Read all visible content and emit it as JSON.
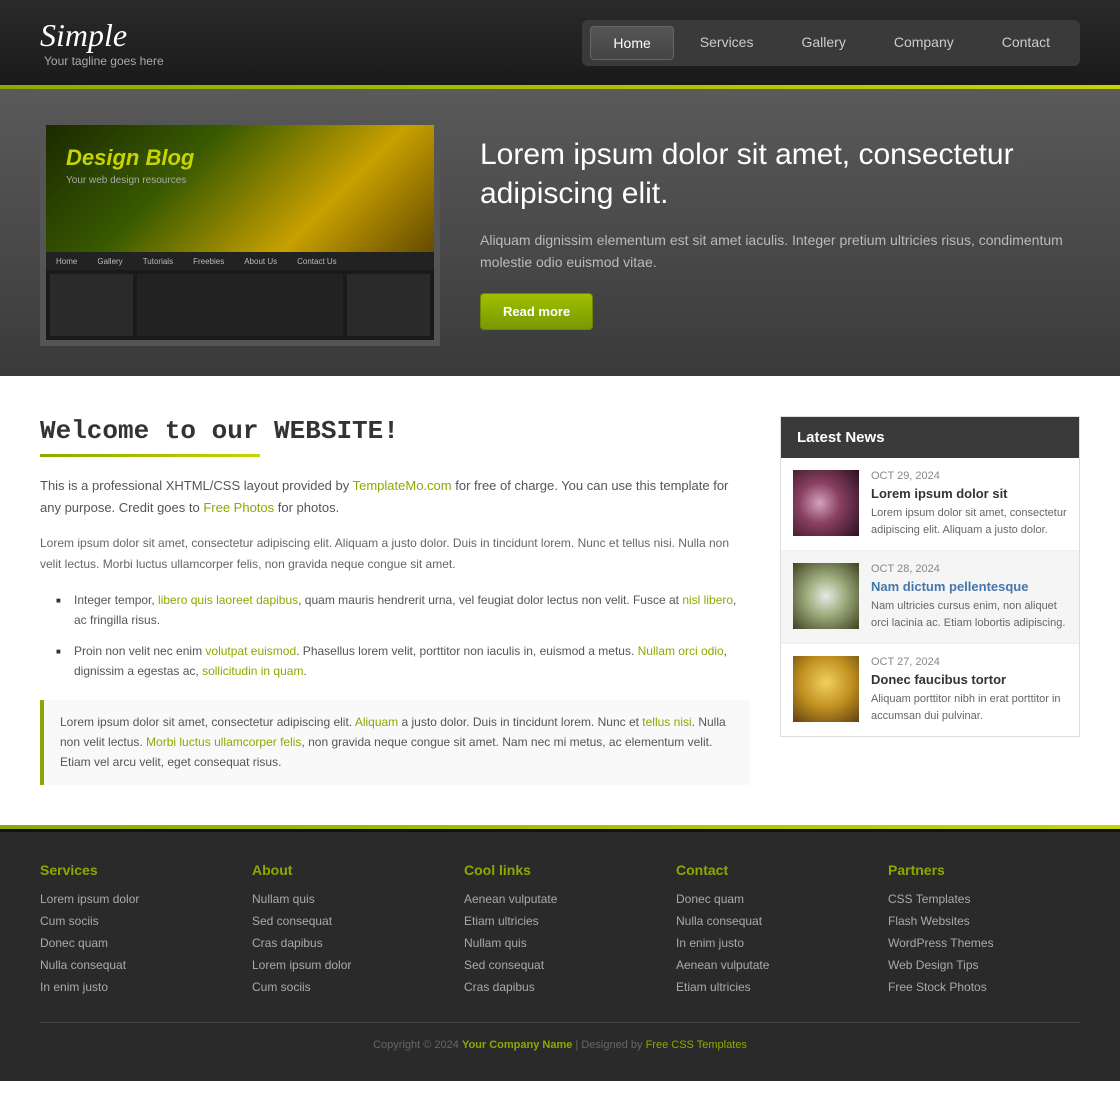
{
  "site": {
    "title": "Simple",
    "tagline": "Your tagline goes here"
  },
  "nav": {
    "items": [
      {
        "label": "Home",
        "active": true
      },
      {
        "label": "Services",
        "active": false
      },
      {
        "label": "Gallery",
        "active": false
      },
      {
        "label": "Company",
        "active": false
      },
      {
        "label": "Contact",
        "active": false
      }
    ]
  },
  "hero": {
    "blog_title": "Design Blog",
    "blog_sub": "Your web design resources",
    "screen_nav": [
      "Home",
      "Gallery",
      "Tutorials",
      "Freebies",
      "About Us",
      "Contact Us"
    ],
    "heading": "Lorem ipsum dolor sit amet, consectetur adipiscing elit.",
    "paragraph": "Aliquam dignissim elementum est sit amet iaculis. Integer pretium ultricies risus, condimentum molestie odio euismod vitae.",
    "cta_label": "Read more"
  },
  "main": {
    "welcome_title": "Welcome to our WEBSITE!",
    "intro_text": "This is a professional XHTML/CSS layout provided by TemplateMo.com for free of charge. You can use this template for any purpose. Credit goes to Free Photos for photos.",
    "body_text": "Lorem ipsum dolor sit amet, consectetur adipiscing elit. Aliquam a justo dolor. Duis in tincidunt lorem. Nunc et tellus nisi. Nulla non velit lectus. Morbi luctus ullamcorper felis, non gravida neque congue sit amet.",
    "bullets": [
      "Integer tempor, libero quis laoreet dapibus, quam mauris hendrerit urna, vel feugiat dolor lectus non velit. Fusce at nisl libero, ac fringilla risus.",
      "Proin non velit nec enim volutpat euismod. Phasellus lorem velit, porttitor non iaculis in, euismod a metus. Nullam orci odio, dignissim a egestas ac, sollicitudin in quam."
    ],
    "blockquote": "Lorem ipsum dolor sit amet, consectetur adipiscing elit. Aliquam a justo dolor. Duis in tincidunt lorem. Nunc et tellus nisi. Nulla non velit lectus. Morbi luctus ullamcorper felis, non gravida neque congue sit amet. Nam nec mi metus, ac elementum velit. Etiam vel arcu velit, eget consequat risus."
  },
  "sidebar": {
    "latest_news_title": "Latest News",
    "news_items": [
      {
        "date": "OCT 29, 2024",
        "title": "Lorem ipsum dolor sit",
        "excerpt": "Lorem ipsum dolor sit amet, consectetur adipiscing elit. Aliquam a justo dolor.",
        "thumb_type": "flowers"
      },
      {
        "date": "OCT 28, 2024",
        "title": "Nam dictum pellentesque",
        "excerpt": "Nam ultricies cursus enim, non aliquet orci lacinia ac. Etiam lobortis adipiscing.",
        "thumb_type": "bee"
      },
      {
        "date": "OCT 27, 2024",
        "title": "Donec faucibus tortor",
        "excerpt": "Aliquam porttitor nibh in erat porttitor in accumsan dui pulvinar.",
        "thumb_type": "gold"
      }
    ]
  },
  "footer": {
    "columns": [
      {
        "title": "Services",
        "links": [
          "Lorem ipsum dolor",
          "Cum sociis",
          "Donec quam",
          "Nulla consequat",
          "In enim justo"
        ]
      },
      {
        "title": "About",
        "links": [
          "Nullam quis",
          "Sed consequat",
          "Cras dapibus",
          "Lorem ipsum dolor",
          "Cum sociis"
        ]
      },
      {
        "title": "Cool links",
        "links": [
          "Aenean vulputate",
          "Etiam ultricies",
          "Nullam quis",
          "Sed consequat",
          "Cras dapibus"
        ]
      },
      {
        "title": "Contact",
        "links": [
          "Donec quam",
          "Nulla consequat",
          "In enim justo",
          "Aenean vulputate",
          "Etiam ultricies"
        ]
      },
      {
        "title": "Partners",
        "links": [
          "CSS Templates",
          "Flash Websites",
          "WordPress Themes",
          "Web Design Tips",
          "Free Stock Photos"
        ]
      }
    ],
    "copyright": "Copyright © 2024",
    "company_name": "Your Company Name",
    "designed_by": "Designed by",
    "designer": "Free CSS Templates"
  }
}
